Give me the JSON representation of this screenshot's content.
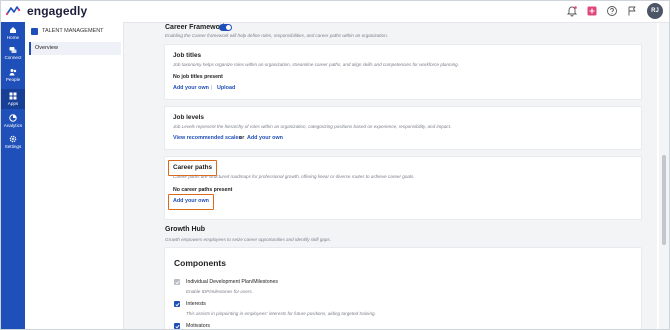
{
  "app": {
    "brand": "engagedly",
    "avatar_initials": "RJ"
  },
  "topbar": {
    "icons": [
      "bell-icon",
      "plus-square-icon",
      "help-icon",
      "flag-icon"
    ]
  },
  "leftnav": {
    "items": [
      {
        "label": "Home",
        "icon": "home-icon"
      },
      {
        "label": "Connect",
        "icon": "chat-icon"
      },
      {
        "label": "People",
        "icon": "people-icon"
      },
      {
        "label": "Apps",
        "icon": "grid-icon"
      },
      {
        "label": "Analytics",
        "icon": "chart-icon"
      },
      {
        "label": "Settings",
        "icon": "gear-icon"
      }
    ],
    "active": "Apps"
  },
  "subnav": {
    "title": "TALENT MANAGEMENT",
    "items": [
      {
        "label": "Overview"
      }
    ]
  },
  "career_framework": {
    "title": "Career Framework",
    "enabled": true,
    "description": "Enabling the Career framework will help define roles, responsibilities, and career paths within an organization."
  },
  "job_titles": {
    "title": "Job titles",
    "description": "Job taxonomy helps organize roles within an organization, streamline career paths, and align skills and competencies for workforce planning.",
    "empty_text": "No job titles present",
    "add_link": "Add your own",
    "separator": "|",
    "upload_link": "Upload"
  },
  "job_levels": {
    "title": "Job levels",
    "description": "Job Levels represent the hierarchy of roles within an organization, categorizing positions based on experience, responsibility, and impact.",
    "view_link": "View recommended scales",
    "or_text": "or",
    "add_link": "Add your own"
  },
  "career_paths": {
    "title": "Career paths",
    "description": "Career paths are structured roadmaps for professional growth, offering linear or diverse routes to achieve career goals.",
    "empty_text": "No career paths present",
    "add_link": "Add your own"
  },
  "growth_hub": {
    "title": "Growth Hub",
    "description": "Growth empowers employees to seize career opportunities and identify skill gaps."
  },
  "components": {
    "title": "Components",
    "items": [
      {
        "label": "Individual Development Plan/Milestones",
        "description": "Enable IDP/milestones for users.",
        "checked": true,
        "disabled": true
      },
      {
        "label": "Interests",
        "description": "This assists in pinpointing in employees' interests for future positions, aiding targeted training.",
        "checked": true,
        "disabled": false
      },
      {
        "label": "Motivators",
        "description": "",
        "checked": true,
        "disabled": false
      }
    ]
  },
  "colors": {
    "brand_blue": "#1f4fb8",
    "highlight_orange": "#d96a1d"
  }
}
